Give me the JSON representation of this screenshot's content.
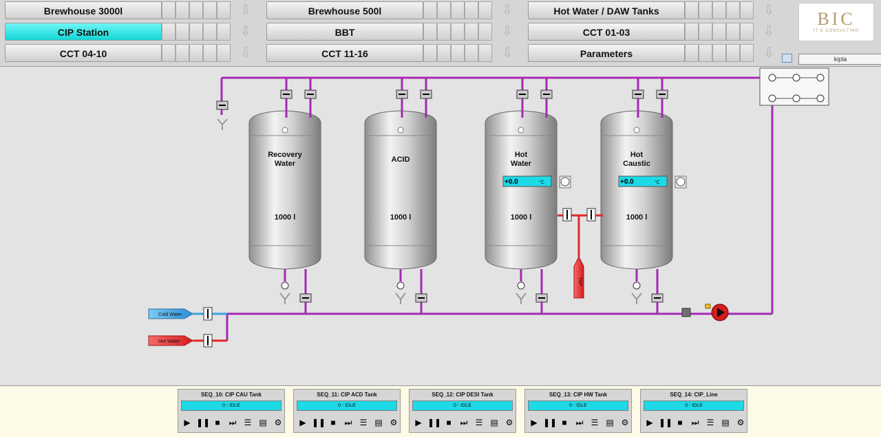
{
  "nav": {
    "rows": [
      [
        "Brewhouse 3000l",
        "Brewhouse 500l",
        "Hot Water / DAW Tanks"
      ],
      [
        "CIP Station",
        "BBT",
        "CCT 01-03"
      ],
      [
        "CCT 04-10",
        "CCT 11-16",
        "Parameters"
      ]
    ],
    "active": "CIP Station"
  },
  "logo": {
    "text": "BIC",
    "sub": "IT & CONSULTING"
  },
  "user": "kipla",
  "tanks": [
    {
      "line1": "Recovery",
      "line2": "Water",
      "volume": "1000 l"
    },
    {
      "line1": "ACID",
      "line2": "",
      "volume": "1000 l"
    },
    {
      "line1": "Hot",
      "line2": "Water",
      "volume": "1000 l",
      "temp": "+0.0",
      "unit": "°C"
    },
    {
      "line1": "Hot",
      "line2": "Caustic",
      "volume": "1000 l",
      "temp": "+0.0",
      "unit": "°C"
    }
  ],
  "inlets": {
    "cold": "Cold Water",
    "hot": "Hot Water"
  },
  "heater_label": "TAP",
  "sequences": [
    {
      "title": "SEQ_10: CIP CAU Tank",
      "status": "0 - IDLE"
    },
    {
      "title": "SEQ_11: CIP ACD Tank",
      "status": "0 - IDLE"
    },
    {
      "title": "SEQ_12: CIP DESI Tank",
      "status": "0 - IDLE"
    },
    {
      "title": "SEQ_13: CIP HW Tank",
      "status": "0 - IDLE"
    },
    {
      "title": "SEQ_14: CIP_Line",
      "status": "0 - IDLE"
    }
  ],
  "colors": {
    "pipe": "#a42ab4",
    "cold": "#3aa4e0",
    "hot": "#e02a2a",
    "accent": "#14d6d6"
  }
}
